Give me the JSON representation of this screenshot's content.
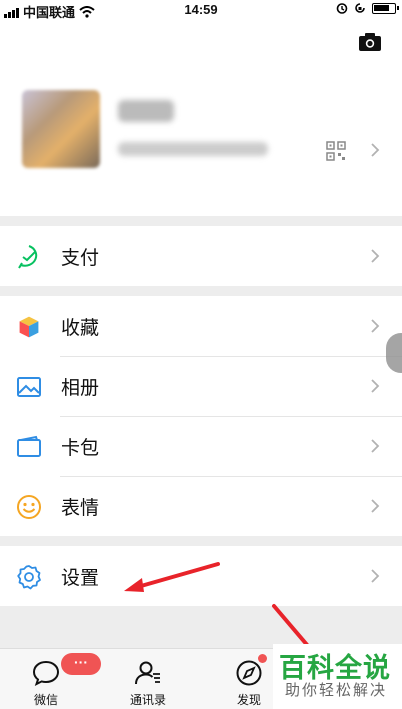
{
  "status_bar": {
    "carrier": "中国联通",
    "time": "14:59"
  },
  "menu": {
    "pay": "支付",
    "favorites": "收藏",
    "album": "相册",
    "cards": "卡包",
    "stickers": "表情",
    "settings": "设置"
  },
  "tabs": {
    "chats": "微信",
    "contacts": "通讯录",
    "discover": "发现",
    "chats_badge": "···"
  },
  "watermark": {
    "title": "百科全说",
    "subtitle": "助你轻松解决"
  },
  "colors": {
    "accent_green": "#07c160",
    "badge_red": "#f05454",
    "arrow_red": "#e8232a",
    "watermark_green": "#26a642"
  }
}
